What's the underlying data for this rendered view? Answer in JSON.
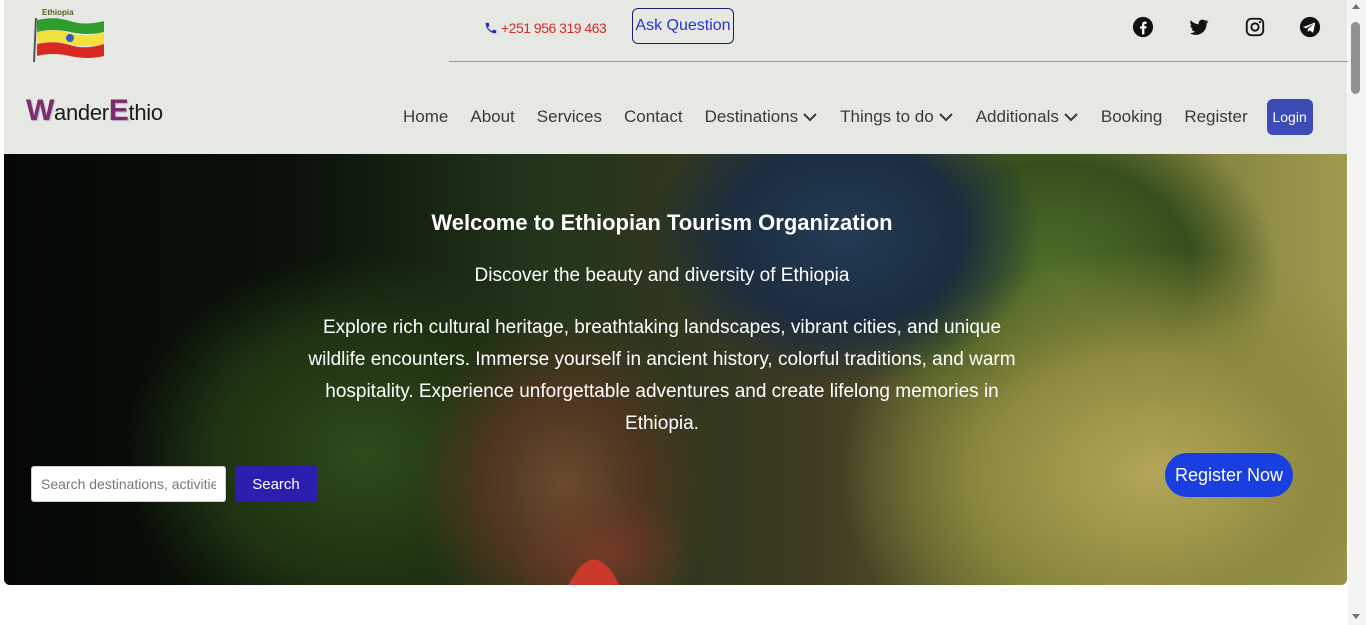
{
  "header": {
    "flag_label": "Ethiopia",
    "phone": "+251 956 319 463",
    "ask_button": "Ask Question",
    "social": [
      "facebook-icon",
      "twitter-icon",
      "instagram-icon",
      "telegram-icon"
    ]
  },
  "logo": {
    "first_initial": "W",
    "first_rest": "ander",
    "second_initial": "E",
    "second_rest": "thio"
  },
  "nav": {
    "items": [
      "Home",
      "About",
      "Services",
      "Contact",
      "Destinations",
      "Things to do",
      "Additionals",
      "Booking",
      "Register"
    ],
    "login": "Login"
  },
  "hero": {
    "title": "Welcome to Ethiopian Tourism Organization",
    "subtitle": "Discover the beauty and diversity of Ethiopia",
    "description": "Explore rich cultural heritage, breathtaking landscapes, vibrant cities, and unique wildlife encounters. Immerse yourself in ancient history, colorful traditions, and warm hospitality. Experience unforgettable adventures and create lifelong memories in Ethiopia.",
    "search_placeholder": "Search destinations, activities",
    "search_button": "Search",
    "register_button": "Register Now"
  },
  "colors": {
    "header_bg": "#e6e8e3",
    "login_bg": "#3c4bb5",
    "search_btn": "#2c1fb0",
    "register_btn": "#1a3fe0",
    "phone_text": "#d42b2b"
  }
}
